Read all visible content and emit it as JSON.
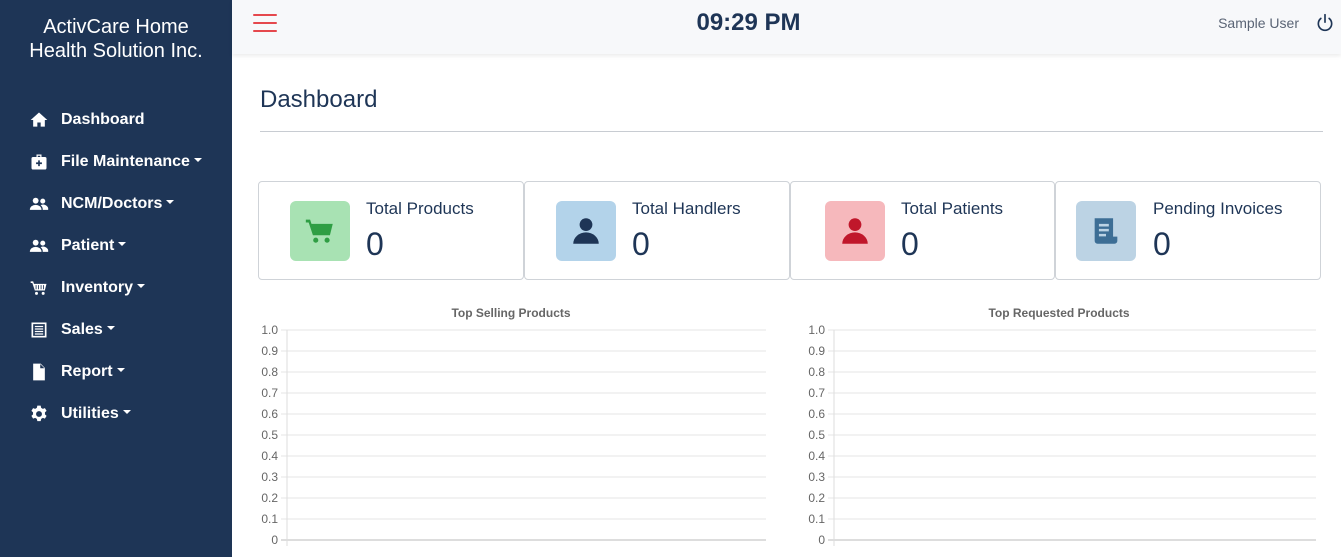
{
  "sidebar": {
    "brand": "ActivCare Home Health Solution Inc.",
    "items": [
      {
        "label": "Dashboard",
        "icon": "home-icon",
        "dropdown": false
      },
      {
        "label": "File Maintenance",
        "icon": "medkit-icon",
        "dropdown": true
      },
      {
        "label": "NCM/Doctors",
        "icon": "users-icon",
        "dropdown": true
      },
      {
        "label": "Patient",
        "icon": "users-icon",
        "dropdown": true
      },
      {
        "label": "Inventory",
        "icon": "cart-icon",
        "dropdown": true
      },
      {
        "label": "Sales",
        "icon": "receipt-icon",
        "dropdown": true
      },
      {
        "label": "Report",
        "icon": "file-icon",
        "dropdown": true
      },
      {
        "label": "Utilities",
        "icon": "gear-icon",
        "dropdown": true
      }
    ]
  },
  "topbar": {
    "time": "09:29 PM",
    "user": "Sample User"
  },
  "main": {
    "title": "Dashboard",
    "cards": [
      {
        "title": "Total Products",
        "value": "0",
        "icon": "cart-icon",
        "tile_color": "#a8e2b3",
        "icon_color": "#2f9e44"
      },
      {
        "title": "Total Handlers",
        "value": "0",
        "icon": "user-icon",
        "tile_color": "#b3d3ea",
        "icon_color": "#1e3556"
      },
      {
        "title": "Total Patients",
        "value": "0",
        "icon": "user-icon",
        "tile_color": "#f6b8bc",
        "icon_color": "#c0172b"
      },
      {
        "title": "Pending Invoices",
        "value": "0",
        "icon": "invoice-icon",
        "tile_color": "#bcd3e4",
        "icon_color": "#3d6e95"
      }
    ]
  },
  "chart_data": [
    {
      "type": "bar",
      "title": "Top Selling Products",
      "categories": [],
      "values": [],
      "ylim": [
        0,
        1.0
      ],
      "yticks": [
        "1.0",
        "0.9",
        "0.8",
        "0.7",
        "0.6",
        "0.5",
        "0.4",
        "0.3",
        "0.2",
        "0.1",
        "0"
      ],
      "grid": true
    },
    {
      "type": "bar",
      "title": "Top Requested Products",
      "categories": [],
      "values": [],
      "ylim": [
        0,
        1.0
      ],
      "yticks": [
        "1.0",
        "0.9",
        "0.8",
        "0.7",
        "0.6",
        "0.5",
        "0.4",
        "0.3",
        "0.2",
        "0.1",
        "0"
      ],
      "grid": true
    }
  ],
  "colors": {
    "sidebar": "#1e3556",
    "accent": "#e5484d"
  }
}
